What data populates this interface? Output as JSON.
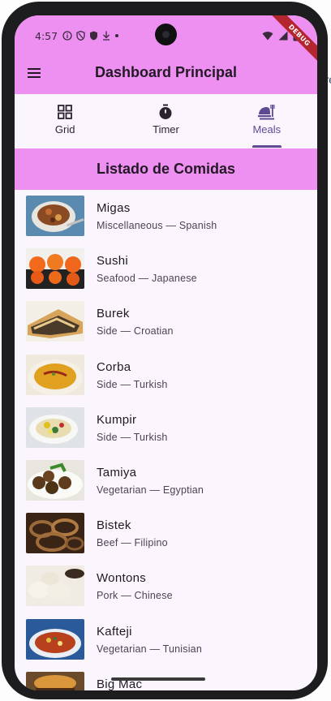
{
  "status_bar": {
    "time": "4:57",
    "left_icons": [
      "info-icon",
      "vpn-shield-icon",
      "security-shield-icon",
      "download-icon",
      "dot-icon"
    ],
    "right_icons": [
      "wifi-icon",
      "signal-icon",
      "battery-icon"
    ],
    "debug_banner": "DEBUG"
  },
  "app_bar": {
    "title": "Dashboard Principal",
    "menu_icon": "hamburger-menu-icon",
    "color": "#ee90f1"
  },
  "tabs": [
    {
      "label": "Grid",
      "icon": "grid-icon",
      "active": false
    },
    {
      "label": "Timer",
      "icon": "stopwatch-icon",
      "active": false
    },
    {
      "label": "Meals",
      "icon": "meal-dish-icon",
      "active": true
    }
  ],
  "section_header": "Listado de Comidas",
  "meals": [
    {
      "name": "Migas",
      "subtitle": "Miscellaneous — Spanish"
    },
    {
      "name": "Sushi",
      "subtitle": "Seafood — Japanese"
    },
    {
      "name": "Burek",
      "subtitle": "Side — Croatian"
    },
    {
      "name": "Corba",
      "subtitle": "Side — Turkish"
    },
    {
      "name": "Kumpir",
      "subtitle": "Side — Turkish"
    },
    {
      "name": "Tamiya",
      "subtitle": "Vegetarian — Egyptian"
    },
    {
      "name": "Bistek",
      "subtitle": "Beef — Filipino"
    },
    {
      "name": "Wontons",
      "subtitle": "Pork — Chinese"
    },
    {
      "name": "Kafteji",
      "subtitle": "Vegetarian — Tunisian"
    },
    {
      "name": "Big Mac",
      "subtitle": ""
    }
  ],
  "colors": {
    "accent": "#ee90f1",
    "active_tab": "#5d4a93",
    "background": "#fbf6fe"
  }
}
